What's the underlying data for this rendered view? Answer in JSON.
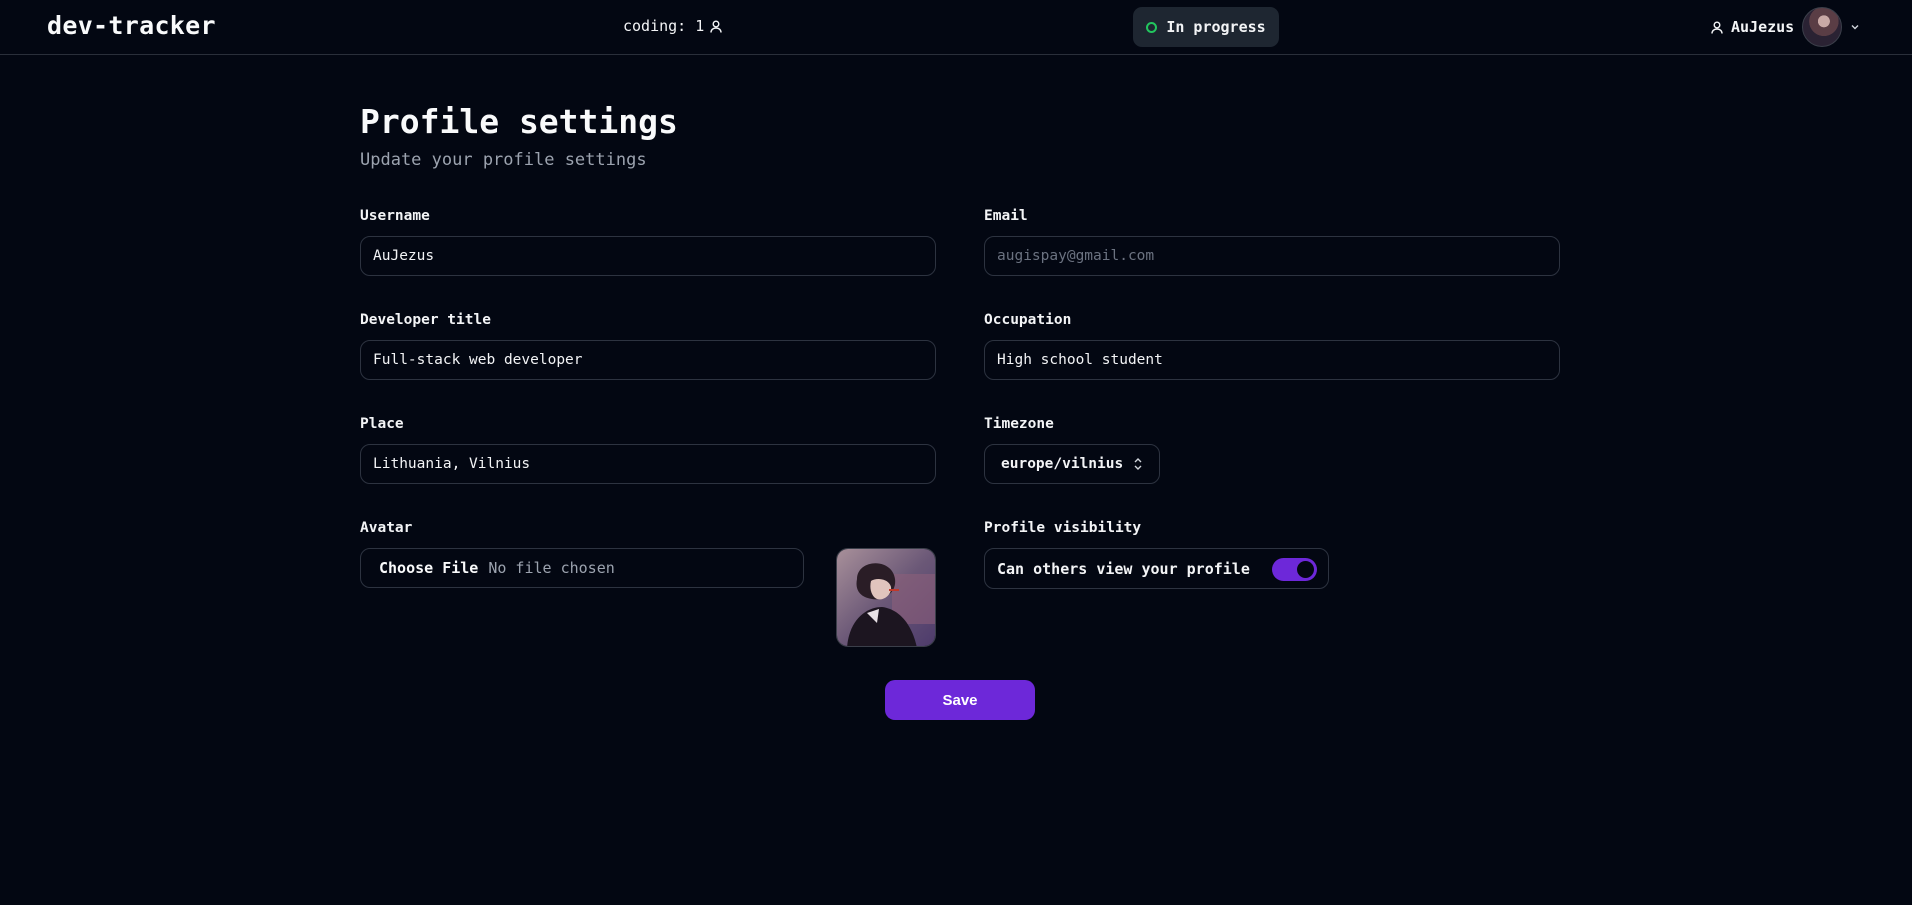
{
  "header": {
    "logo": "dev-tracker",
    "coding_status": "coding: 1",
    "status_pill": "In progress",
    "username": "AuJezus"
  },
  "page": {
    "title": "Profile settings",
    "subtitle": "Update your profile settings"
  },
  "form": {
    "username": {
      "label": "Username",
      "value": "AuJezus"
    },
    "email": {
      "label": "Email",
      "value": "",
      "placeholder": "augispay@gmail.com"
    },
    "developer_title": {
      "label": "Developer title",
      "value": "Full-stack web developer"
    },
    "occupation": {
      "label": "Occupation",
      "value": "High school student"
    },
    "place": {
      "label": "Place",
      "value": "Lithuania, Vilnius"
    },
    "timezone": {
      "label": "Timezone",
      "value": "europe/vilnius"
    },
    "avatar": {
      "label": "Avatar",
      "button": "Choose File",
      "status": "No file chosen"
    },
    "visibility": {
      "label": "Profile visibility",
      "toggle_label": "Can others view your profile",
      "enabled": true
    },
    "save_label": "Save"
  },
  "colors": {
    "background": "#030712",
    "accent": "#6d28d9",
    "status_dot": "#22c55e",
    "pill_bg": "#1e2631"
  },
  "icons": {
    "coding": "user-icon",
    "status": "circle-icon",
    "user": "user-icon",
    "menu": "chevron-down-icon",
    "select": "chevrons-up-down-icon"
  }
}
